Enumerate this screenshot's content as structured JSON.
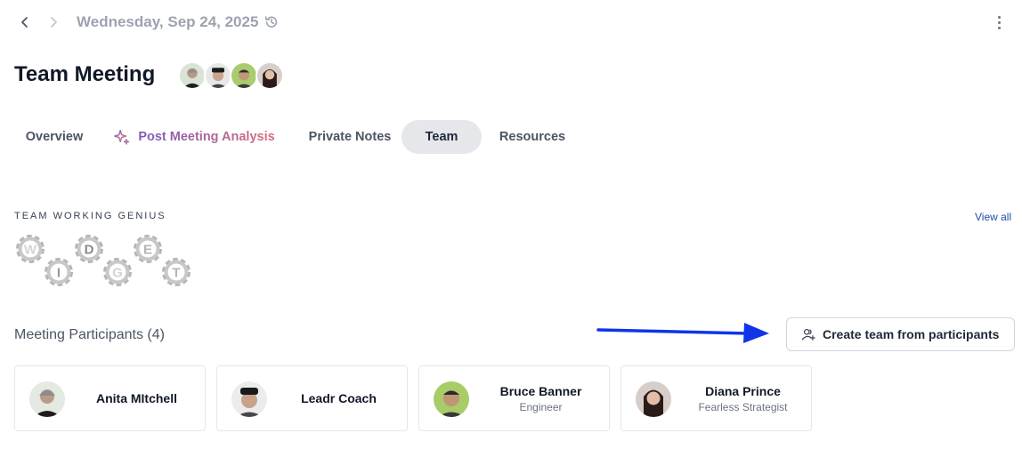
{
  "header": {
    "date": "Wednesday, Sep 24, 2025"
  },
  "meeting": {
    "title": "Team Meeting"
  },
  "tabs": [
    {
      "label": "Overview"
    },
    {
      "label": "Post Meeting Analysis"
    },
    {
      "label": "Private Notes"
    },
    {
      "label": "Team",
      "active": true
    },
    {
      "label": "Resources"
    }
  ],
  "genius": {
    "section_label": "TEAM WORKING GENIUS",
    "view_all": "View all",
    "gears": [
      "W",
      "I",
      "D",
      "G",
      "E",
      "T"
    ]
  },
  "participants": {
    "title": "Meeting Participants (4)",
    "create_label": "Create team from participants",
    "list": [
      {
        "name": "Anita MItchell",
        "role": ""
      },
      {
        "name": "Leadr Coach",
        "role": ""
      },
      {
        "name": "Bruce Banner",
        "role": "Engineer"
      },
      {
        "name": "Diana Prince",
        "role": "Fearless Strategist"
      }
    ]
  },
  "colors": {
    "accent_blue": "#1e4fa3",
    "arrow_blue": "#1034e8",
    "active_tab_bg": "#e5e7eb",
    "gear_gray": "#b8b8b8"
  }
}
